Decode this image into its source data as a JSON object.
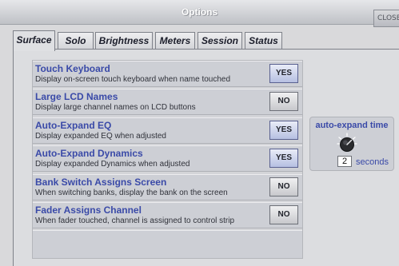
{
  "window": {
    "title": "Options",
    "close_label": "CLOSE"
  },
  "tabs": [
    {
      "label": "Surface",
      "active": true
    },
    {
      "label": "Solo"
    },
    {
      "label": "Brightness"
    },
    {
      "label": "Meters"
    },
    {
      "label": "Session"
    },
    {
      "label": "Status"
    }
  ],
  "options": [
    {
      "title": "Touch Keyboard",
      "desc": "Display on-screen touch keyboard when name touched",
      "value": "YES"
    },
    {
      "title": "Large LCD Names",
      "desc": "Display large channel names on LCD buttons",
      "value": "NO"
    },
    {
      "title": "Auto-Expand EQ",
      "desc": "Display expanded EQ when adjusted",
      "value": "YES"
    },
    {
      "title": "Auto-Expand Dynamics",
      "desc": "Display expanded Dynamics when adjusted",
      "value": "YES"
    },
    {
      "title": "Bank Switch Assigns Screen",
      "desc": "When switching banks, display the bank on the screen",
      "value": "NO"
    },
    {
      "title": "Fader Assigns Channel",
      "desc": "When fader touched, channel is assigned to control strip",
      "value": "NO"
    }
  ],
  "auto_expand": {
    "label": "auto-expand time",
    "value": "2",
    "unit": "seconds",
    "knob_icon": "rotary-knob-icon"
  },
  "colors": {
    "accent": "#3a4aa8",
    "yes_button": "#b6c0e2"
  }
}
